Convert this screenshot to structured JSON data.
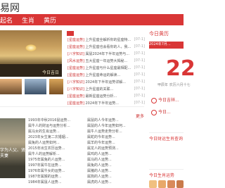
{
  "site": {
    "logo_text": "易网"
  },
  "nav": {
    "items": [
      "起名",
      "生肖",
      "黄历"
    ]
  },
  "hero": {
    "caption": "今日吉日"
  },
  "news": {
    "items": [
      {
        "cat": "[星座运势]",
        "title": "上升星座全解析你的星座特...",
        "date": "[07-1]"
      },
      {
        "cat": "[星座运势]",
        "title": "上升星座也会看你的人，我...",
        "date": "[07-1]"
      },
      {
        "cat": "[八字知识]",
        "title": "属鼠2024年下半年运势与...",
        "date": "[07-1]"
      },
      {
        "cat": "[风水运势]",
        "title": "五大星座一年运势大揭秘...",
        "date": "[07-1]"
      },
      {
        "cat": "[星座运势]",
        "title": "上升星座与什么星座最相配...",
        "date": "[07-1]"
      },
      {
        "cat": "[星座运势]",
        "title": "上升星座命运的解读...",
        "date": "[07-1]"
      },
      {
        "cat": "[八字知识]",
        "title": "2024年下半年运势详解...",
        "date": "[07-1]"
      },
      {
        "cat": "[八字知识]",
        "title": "上升星座的关联...",
        "date": "[07-1]"
      },
      {
        "cat": "[星座运势]",
        "title": "最新星座运势分析...",
        "date": "[07-1]"
      },
      {
        "cat": "[星座运势]",
        "title": "2024年下半年运势...",
        "date": "[07-1]"
      }
    ]
  },
  "more_label": "更多",
  "bottom": {
    "photo_caption": "字为人父、贤夫妻",
    "left_list": [
      "1993年中秋2016鼠运势...",
      "属牛人的财运与运势分析...",
      "属马女的生肖运势...",
      "2023年女生第二次婚姻...",
      "属兔的人运势如何...",
      "2015年出生农历运势...",
      "属牛人的运势解析...",
      "1975年属兔的人运势...",
      "1997年属牛在运势...",
      "1976年属牛女的运势...",
      "1987年属猴的运势...",
      "1984年属鼠人运势..."
    ],
    "right_list": [
      "属鼠的人今年运势...",
      "属鼠的人今年运势如何...",
      "属牛人运势走势分析...",
      "属蛇的今年运势...",
      "属羊的今年运势...",
      "属龙人的运势预测...",
      "属鸡的人运势...",
      "属马的人运势...",
      "属兔的人运势...",
      "属猪的人运势...",
      "属狗的人运势...",
      "属虎的人运势..."
    ]
  },
  "sidebar": {
    "today_title": "今日黄历",
    "date_bar": "2024年7月...",
    "big_day": "22",
    "lunar": "甲辰年 农历六月十七",
    "yi_label": "宜",
    "yi_text": "今日吉祥...",
    "ji_label": "忌",
    "ji_text": "今日...",
    "luck_title": "今日财运生肖查询",
    "luck_title2": "今日生肖运势"
  },
  "colors": {
    "accent": "#d93636"
  }
}
